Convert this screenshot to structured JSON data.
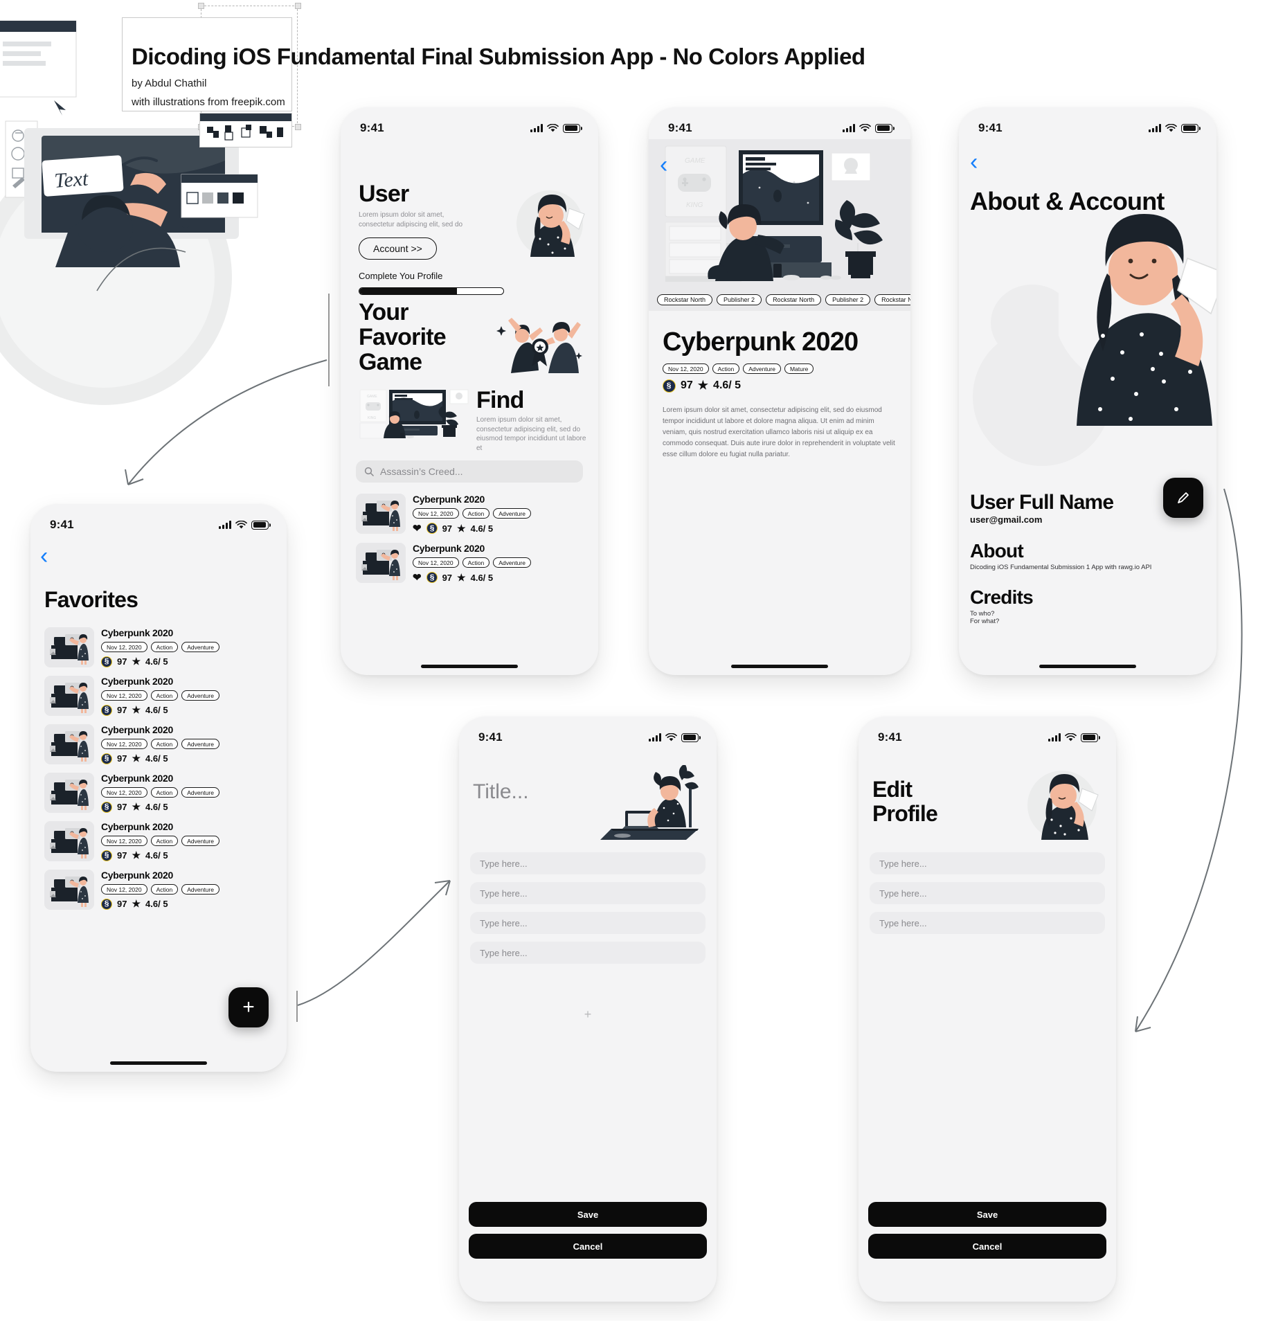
{
  "header": {
    "title": "Dicoding iOS Fundamental Final Submission App - No Colors Applied",
    "author": "by Abdul Chathil",
    "credit": "with illustrations from freepik.com"
  },
  "status_bar": {
    "time": "9:41"
  },
  "screens": {
    "user": {
      "heading": "User",
      "subtitle": "Lorem ipsum dolor sit amet,\nconsectetur adipiscing elit, sed do",
      "account_button": "Account >>",
      "progress_label": "Complete You Profile",
      "progress_percent": 68,
      "favorite_heading": "Your\nFavorite\nGame",
      "find_heading": "Find",
      "find_body": "Lorem ipsum dolor sit amet, consectetur adipiscing elit, sed do eiusmod tempor incididunt ut labore et",
      "search_placeholder": "Assassin’s Creed...",
      "games": [
        {
          "title": "Cyberpunk 2020",
          "tags": [
            "Nov 12, 2020",
            "Action",
            "Adventure"
          ],
          "favorited": true,
          "metacritic": "97",
          "rating": "4.6/ 5"
        },
        {
          "title": "Cyberpunk 2020",
          "tags": [
            "Nov 12, 2020",
            "Action",
            "Adventure"
          ],
          "favorited": true,
          "metacritic": "97",
          "rating": "4.6/ 5"
        }
      ]
    },
    "detail": {
      "back_icon": "chevron-left-icon",
      "hero_chips": [
        "Rockstar North",
        "Publisher 2",
        "Rockstar North",
        "Publisher 2",
        "Rockstar N"
      ],
      "title": "Cyberpunk 2020",
      "tags": [
        "Nov 12, 2020",
        "Action",
        "Adventure",
        "Mature"
      ],
      "metacritic": "97",
      "rating": "4.6/ 5",
      "description": "Lorem ipsum dolor sit amet, consectetur adipiscing elit, sed do eiusmod tempor incididunt ut labore et dolore magna aliqua. Ut enim ad minim veniam, quis nostrud exercitation ullamco laboris nisi ut aliquip ex ea commodo consequat. Duis aute irure dolor in reprehenderit in voluptate velit esse cillum dolore eu fugiat nulla pariatur."
    },
    "about": {
      "back_icon": "chevron-left-icon",
      "heading": "About & Account",
      "user_name": "User Full Name",
      "user_email": "user@gmail.com",
      "about_heading": "About",
      "about_body": "Dicoding iOS Fundamental Submission 1 App with rawg.io API",
      "credits_heading": "Credits",
      "credits_line1": "To who?",
      "credits_line2": "For what?",
      "edit_icon": "pencil-icon"
    },
    "favorites": {
      "back_icon": "chevron-left-icon",
      "heading": "Favorites",
      "add_icon": "plus-icon",
      "games": [
        {
          "title": "Cyberpunk 2020",
          "tags": [
            "Nov 12, 2020",
            "Action",
            "Adventure"
          ],
          "metacritic": "97",
          "rating": "4.6/ 5"
        },
        {
          "title": "Cyberpunk 2020",
          "tags": [
            "Nov 12, 2020",
            "Action",
            "Adventure"
          ],
          "metacritic": "97",
          "rating": "4.6/ 5"
        },
        {
          "title": "Cyberpunk 2020",
          "tags": [
            "Nov 12, 2020",
            "Action",
            "Adventure"
          ],
          "metacritic": "97",
          "rating": "4.6/ 5"
        },
        {
          "title": "Cyberpunk 2020",
          "tags": [
            "Nov 12, 2020",
            "Action",
            "Adventure"
          ],
          "metacritic": "97",
          "rating": "4.6/ 5"
        },
        {
          "title": "Cyberpunk 2020",
          "tags": [
            "Nov 12, 2020",
            "Action",
            "Adventure"
          ],
          "metacritic": "97",
          "rating": "4.6/ 5"
        },
        {
          "title": "Cyberpunk 2020",
          "tags": [
            "Nov 12, 2020",
            "Action",
            "Adventure"
          ],
          "metacritic": "97",
          "rating": "4.6/ 5"
        }
      ]
    },
    "add_form": {
      "heading": "Title...",
      "fields": [
        "Type here...",
        "Type here...",
        "Type here...",
        "Type here..."
      ],
      "add_more_icon": "plus-icon",
      "save_label": "Save",
      "cancel_label": "Cancel"
    },
    "edit_profile": {
      "heading": "Edit\nProfile",
      "fields": [
        "Type here...",
        "Type here...",
        "Type here..."
      ],
      "save_label": "Save",
      "cancel_label": "Cancel"
    }
  },
  "colors": {
    "accent_blue": "#147efb",
    "ink": "#0b0b0b",
    "phone_bg": "#f4f4f5",
    "chip_bg": "#e9e9eb",
    "metacritic_gold": "#e8c21a"
  }
}
